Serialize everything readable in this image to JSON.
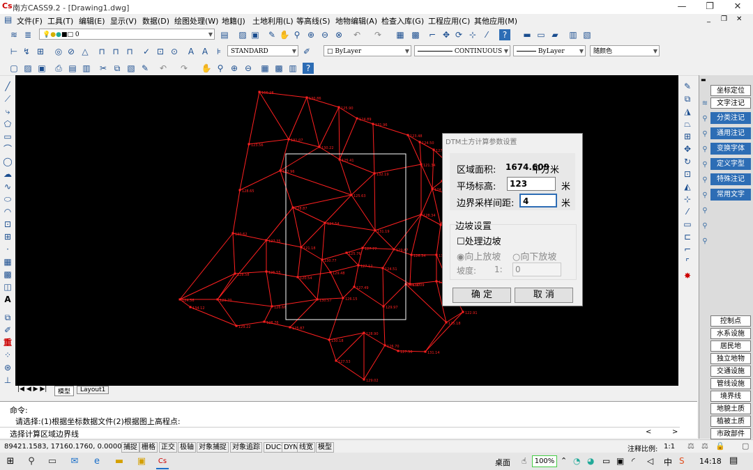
{
  "window": {
    "title": "南方CASS9.2 - [Drawing1.dwg]",
    "app_icon": "Cs"
  },
  "menu": [
    "文件(F)",
    "工具(T)",
    "编辑(E)",
    "显示(V)",
    "数据(D)",
    "绘图处理(W)",
    "地籍(J)",
    "土地利用(L)",
    "等高线(S)",
    "地物编辑(A)",
    "检查入库(G)",
    "工程应用(C)",
    "其他应用(M)"
  ],
  "toolbar": {
    "layer_value": "0",
    "text_style": "STANDARD",
    "color": "ByLayer",
    "linetype": "CONTINUOUS",
    "lineweight": "ByLayer",
    "plot_color": "随颜色"
  },
  "tabs": {
    "model": "模型",
    "layout": "Layout1"
  },
  "right_panel": {
    "top": [
      "坐标定位",
      "文字注记",
      "分类注记",
      "通用注记",
      "变换字体",
      "定义字型",
      "特殊注记",
      "常用文字"
    ],
    "bottom": [
      "控制点",
      "水系设施",
      "居民地",
      "独立地物",
      "交通设施",
      "管线设施",
      "境界线",
      "地貌土质",
      "植被土质",
      "市政部件"
    ]
  },
  "command": {
    "line1": "命令:",
    "line2": "请选择:(1)根据坐标数据文件(2)根据图上高程点:",
    "line3": "选择计算区域边界线"
  },
  "status": {
    "coords": "89421.1583, 17160.1760, 0.0000",
    "toggles": [
      "捕捉",
      "栅格",
      "正交",
      "极轴",
      "对象捕捉",
      "对象追踪",
      "DUCS",
      "DYN",
      "线宽",
      "模型"
    ],
    "scale_label": "注释比例:",
    "scale_value": "1:1"
  },
  "taskbar": {
    "desktop": "桌面",
    "battery": "100%",
    "ime": "中",
    "time": "14:18"
  },
  "dialog": {
    "title": "DTM土方计算参数设置",
    "area_label": "区域面积:",
    "area_value": "1674.609",
    "area_unit": "平方米",
    "elev_label": "平场标高:",
    "elev_value": "123",
    "elev_unit": "米",
    "sample_label": "边界采样间距:",
    "sample_value": "4",
    "sample_unit": "米",
    "slope_group": "边坡设置",
    "process_slope": "处理边坡",
    "up_slope": "向上放坡",
    "down_slope": "向下放坡",
    "slope_label": "坡度:",
    "slope_ratio": "1:",
    "slope_value": "0",
    "ok": "确 定",
    "cancel": "取 消"
  },
  "network": {
    "color": "#ff2020",
    "points": [
      {
        "l": "166.28"
      },
      {
        "l": "130.86"
      },
      {
        "l": "125.90"
      },
      {
        "l": "124.89"
      },
      {
        "l": "131.96"
      },
      {
        "l": "123.48"
      },
      {
        "l": "124.50"
      },
      {
        "l": "127.08"
      },
      {
        "l": "128.21"
      },
      {
        "l": "128.51"
      },
      {
        "l": "123.56"
      },
      {
        "l": "131.07"
      },
      {
        "l": "130.22"
      },
      {
        "l": "125.41"
      },
      {
        "l": "132.19"
      },
      {
        "l": "121.34"
      },
      {
        "l": "124.10"
      },
      {
        "l": "124.93"
      },
      {
        "l": "128.65"
      },
      {
        "l": "132.96"
      },
      {
        "l": "128.87"
      },
      {
        "l": "124.54"
      },
      {
        "l": "125.63"
      },
      {
        "l": "131.19"
      },
      {
        "l": "128.34"
      },
      {
        "l": "126.95"
      },
      {
        "l": "130.62"
      },
      {
        "l": "127.35"
      },
      {
        "l": "121.18"
      },
      {
        "l": "130.77"
      },
      {
        "l": "125.76"
      },
      {
        "l": "127.77"
      },
      {
        "l": "129.87"
      },
      {
        "l": "126.34"
      },
      {
        "l": "134.76"
      },
      {
        "l": "128.58"
      },
      {
        "l": "125.55"
      },
      {
        "l": "120.54"
      },
      {
        "l": "129.48"
      },
      {
        "l": "127.12"
      },
      {
        "l": "124.51"
      },
      {
        "l": "123.09"
      },
      {
        "l": "128.16"
      },
      {
        "l": "131.82"
      },
      {
        "l": "124.56"
      },
      {
        "l": "129.70"
      },
      {
        "l": "126.66"
      },
      {
        "l": "130.57"
      },
      {
        "l": "126.15"
      },
      {
        "l": "127.49"
      },
      {
        "l": "129.97"
      },
      {
        "l": "126.97"
      },
      {
        "l": "125.18"
      },
      {
        "l": "122.91"
      },
      {
        "l": "134.12"
      },
      {
        "l": "129.22"
      },
      {
        "l": "128.76"
      },
      {
        "l": "125.87"
      },
      {
        "l": "130.18"
      },
      {
        "l": "128.90"
      },
      {
        "l": "126.70"
      },
      {
        "l": "127.56"
      },
      {
        "l": "131.14"
      },
      {
        "l": "127.53"
      },
      {
        "l": "129.02"
      }
    ]
  }
}
